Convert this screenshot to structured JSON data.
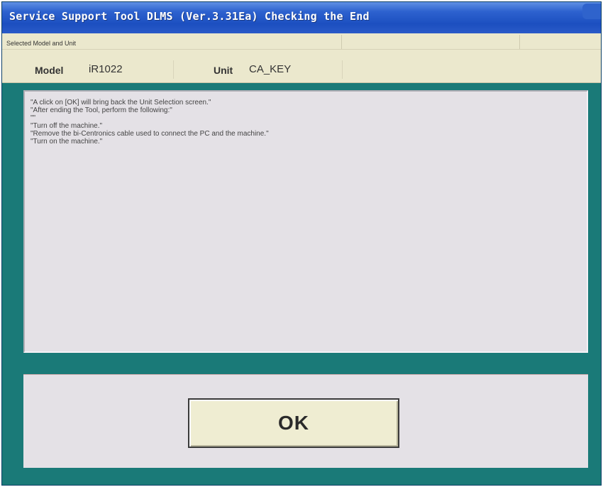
{
  "window": {
    "title": "Service Support Tool DLMS (Ver.3.31Ea) Checking the End"
  },
  "selection": {
    "caption": "Selected Model and Unit",
    "model_label": "Model",
    "model_value": "iR1022",
    "unit_label": "Unit",
    "unit_value": "CA_KEY"
  },
  "message": {
    "lines": [
      "\"A click on [OK] will bring back the Unit Selection screen.\"",
      "\"After ending the Tool, perform the following:\"",
      "\"\"",
      "\"Turn off the machine.\"",
      "\"Remove the bi-Centronics cable used to connect the PC and the machine.\"",
      "\"Turn on the machine.\""
    ]
  },
  "actions": {
    "ok_label": "OK"
  },
  "colors": {
    "window_background": "#1a7a78",
    "titlebar": "#1c4fc0",
    "panel": "#e4e1e6",
    "info_panel": "#ebe8cd",
    "button": "#efedd2"
  }
}
